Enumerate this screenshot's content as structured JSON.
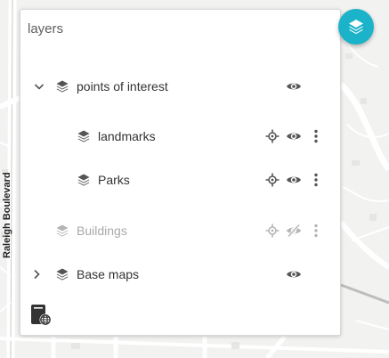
{
  "map": {
    "road_label": "Raleigh Boulevard"
  },
  "panel": {
    "title": "layers"
  },
  "layers": [
    {
      "label": "points of interest",
      "expandable": true,
      "expanded": true,
      "visible": true,
      "disabled": false
    },
    {
      "label": "landmarks",
      "visible": true,
      "disabled": false
    },
    {
      "label": "Parks",
      "visible": true,
      "disabled": false
    },
    {
      "label": "Buildings",
      "visible": false,
      "disabled": true
    },
    {
      "label": "Base maps",
      "expandable": true,
      "expanded": false,
      "visible": true,
      "disabled": false
    }
  ],
  "colors": {
    "accent": "#1bb3c9",
    "icon": "#555555",
    "icon_disabled": "#b5b5b5"
  }
}
